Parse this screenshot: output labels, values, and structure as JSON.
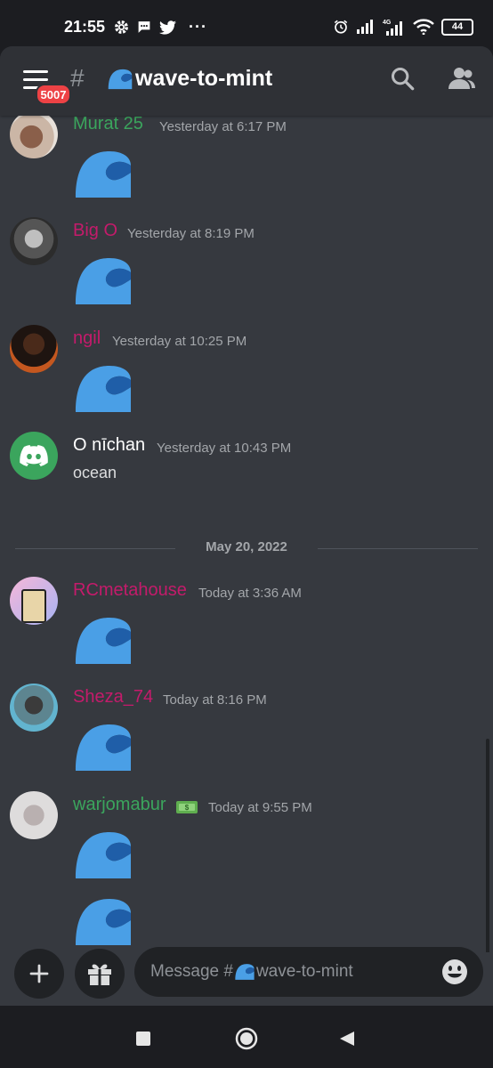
{
  "status_bar": {
    "time": "21:55",
    "left_icons": [
      "gear-icon",
      "message-icon",
      "twitter-icon"
    ],
    "dots": "···",
    "right_icons": [
      "alarm-icon",
      "signal-icon",
      "signal-4g-icon",
      "wifi-icon"
    ],
    "battery": "44"
  },
  "header": {
    "menu_badge": "5007",
    "hash": "#",
    "channel_emoji": "wave-emoji",
    "channel_name": "wave-to-mint",
    "search_icon": "search-icon",
    "members_icon": "members-icon"
  },
  "colors": {
    "background": "#36393f",
    "header": "#2f3136",
    "green_name": "#3ba55d",
    "pink_name": "#c41b6b",
    "white_name": "#ffffff",
    "wave": "#4a9fe6",
    "wave_dark": "#3177c2"
  },
  "messages": [
    {
      "author": "Murat 25",
      "time": "Yesterday at 6:17 PM",
      "content": "wave-emoji"
    },
    {
      "author": "Big O",
      "time": "Yesterday at 8:19 PM",
      "content": "wave-emoji"
    },
    {
      "author": "ngil",
      "time": "Yesterday at 10:25 PM",
      "content": "wave-emoji"
    },
    {
      "author": "O nīchan",
      "time": "Yesterday at 10:43 PM",
      "text": "ocean"
    },
    {
      "author": "RCmetahouse",
      "time": "Today at 3:36 AM",
      "content": "wave-emoji"
    },
    {
      "author": "Sheza_74",
      "time": "Today at 8:16 PM",
      "content": "wave-emoji"
    },
    {
      "author": "warjomabur",
      "author_emoji": "money-emoji",
      "time": "Today at 9:55 PM",
      "content": "wave-emoji x2"
    }
  ],
  "date_divider": "May 20, 2022",
  "composer": {
    "add_icon": "plus-icon",
    "gift_icon": "gift-icon",
    "placeholder_prefix": "Message #",
    "placeholder_emoji": "wave-emoji",
    "placeholder_channel": "wave-to-mint",
    "emoji_icon": "smiley-icon"
  },
  "navbar": [
    "recent-apps-icon",
    "home-icon",
    "back-icon"
  ]
}
